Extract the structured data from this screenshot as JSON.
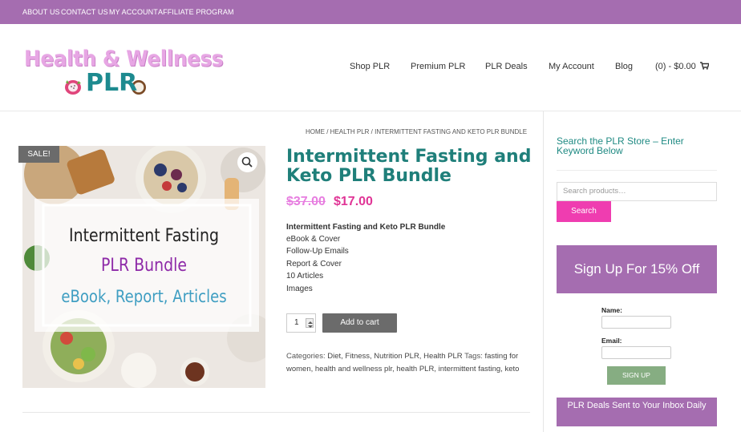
{
  "topbar": {
    "links": [
      "ABOUT US",
      "CONTACT US",
      "MY ACCOUNT",
      "AFFILIATE PROGRAM"
    ]
  },
  "logo": {
    "line1": "Health & Wellness",
    "line2": "PLR"
  },
  "nav": {
    "items": [
      "Shop PLR",
      "Premium PLR",
      "PLR Deals",
      "My Account",
      "Blog"
    ],
    "cart": "(0) - $0.00",
    "cart_icon": "shopping-cart-icon"
  },
  "breadcrumb": "HOME / HEALTH PLR / INTERMITTENT FASTING AND KETO PLR BUNDLE",
  "product": {
    "sale_badge": "SALE!",
    "zoom_icon": "magnifier-icon",
    "image_text": {
      "line1": "Intermittent Fasting",
      "line2": "PLR Bundle",
      "line3": "eBook, Report, Articles"
    },
    "title": "Intermittent Fasting and Keto PLR Bundle",
    "price_old": "$37.00",
    "price_new": "$17.00",
    "desc_heading": "Intermittent Fasting and Keto PLR Bundle",
    "desc_items": [
      "eBook & Cover",
      "Follow-Up Emails",
      "Report & Cover",
      "10 Articles",
      "Images"
    ],
    "qty": "1",
    "add_to_cart": "Add to cart",
    "categories_label": "Categories:",
    "categories": "Diet, Fitness, Nutrition PLR, Health PLR",
    "tags_label": "Tags:",
    "tags": "fasting for women, health and wellness plr, health PLR, intermittent fasting, keto"
  },
  "sidebar": {
    "search_title": "Search the PLR Store – Enter Keyword Below",
    "search_placeholder": "Search products…",
    "search_button": "Search",
    "signup_title": "Sign Up For 15% Off",
    "name_label": "Name:",
    "email_label": "Email:",
    "signup_button": "SIGN UP",
    "deals_text": "PLR Deals Sent to Your Inbox Daily"
  },
  "colors": {
    "brand_purple": "#a56db0",
    "title_teal": "#1f7f7a",
    "price_pink": "#e03596",
    "search_button_pink": "#ef3db0",
    "signup_green": "#86ad82"
  }
}
